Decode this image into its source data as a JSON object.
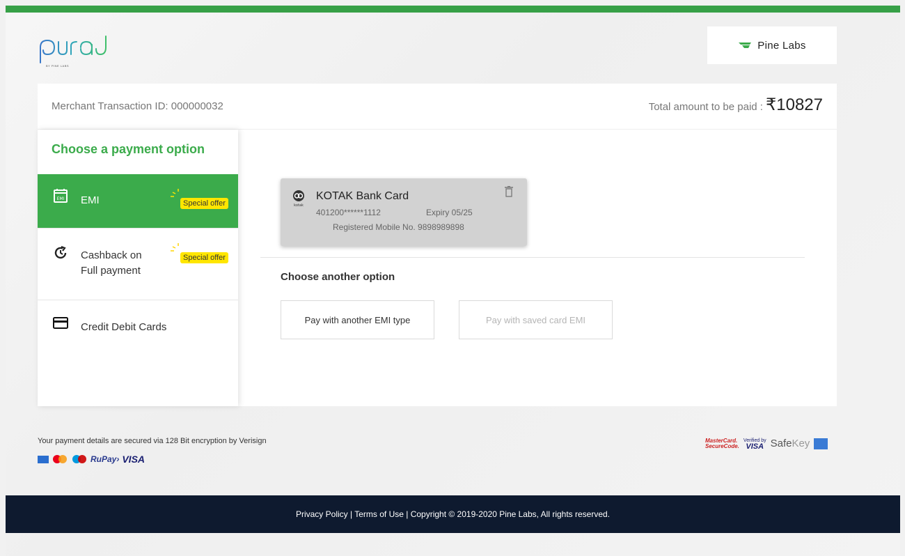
{
  "brand": {
    "logo_sub": "BY PINE LABS",
    "partner": "Pine Labs",
    "accent": "#3bab4b",
    "topbar": "#37a047"
  },
  "header": {
    "txn_label": "Merchant Transaction ID: 000000032",
    "total_label": "Total amount to be paid :",
    "total_amount": "₹10827"
  },
  "sidebar": {
    "title": "Choose a payment option",
    "items": [
      {
        "label": "EMI",
        "badge": "Special offer",
        "icon": "calendar-emi-icon",
        "active": true
      },
      {
        "label_1": "Cashback on",
        "label_2": "Full payment",
        "badge": "Special offer",
        "icon": "cashback-clock-icon",
        "active": false
      },
      {
        "label": "Credit Debit Cards",
        "icon": "credit-card-icon",
        "active": false
      }
    ]
  },
  "saved_card": {
    "bank": "KOTAK Bank Card",
    "logo_text": "kotak",
    "number": "401200******1112",
    "expiry": "Expiry 05/25",
    "mobile": "Registered Mobile No. 9898989898"
  },
  "another": {
    "title": "Choose another option",
    "btn_emi": "Pay with another EMI type",
    "btn_saved": "Pay with saved card EMI"
  },
  "security": {
    "text": "Your payment details are secured via 128 Bit encryption by Verisign",
    "rupay": "RuPay›",
    "visa": "VISA",
    "mc_secure_1": "MasterCard.",
    "mc_secure_2": "SecureCode.",
    "verified_by": "Verified by",
    "verified_visa": "VISA",
    "safe": "Safe",
    "key": "Key"
  },
  "footer": {
    "text": "Privacy Policy | Terms of Use | Copyright © 2019-2020 Pine Labs, All rights reserved."
  }
}
